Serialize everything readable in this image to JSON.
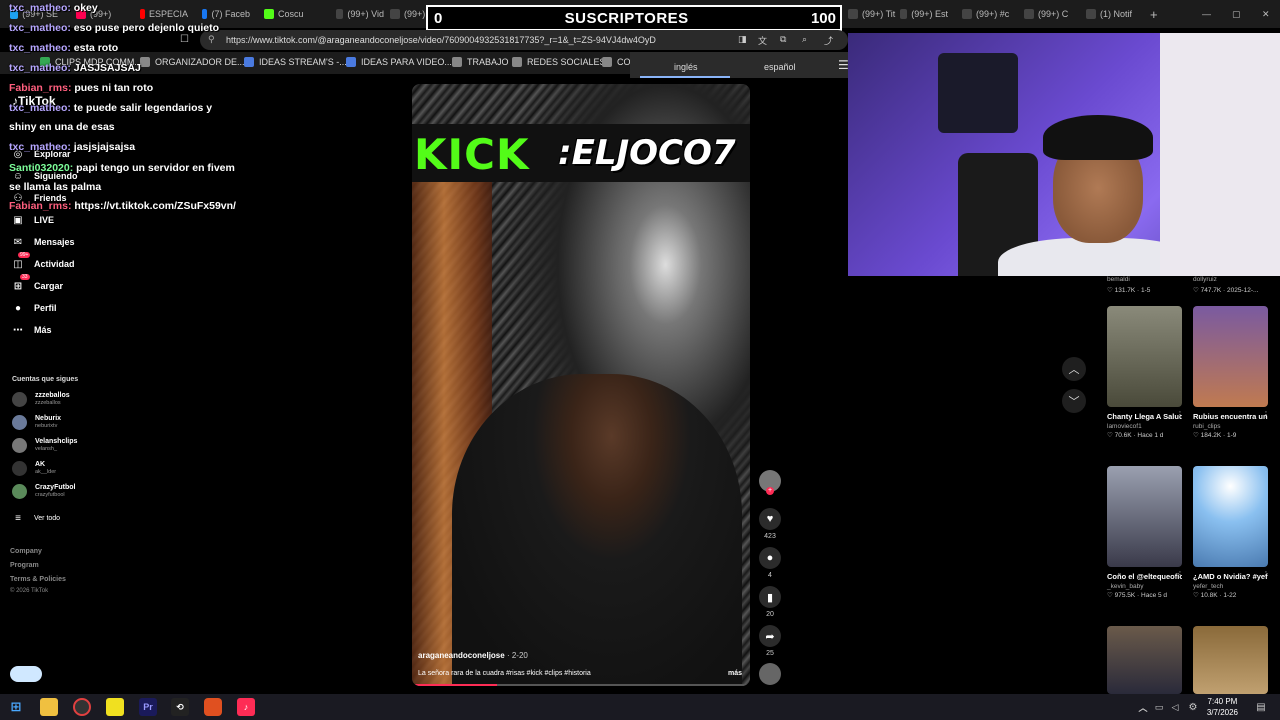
{
  "tabs": [
    {
      "label": "(99+) SE",
      "color": "#1da1f2"
    },
    {
      "label": "(99+) ",
      "color": "#ff0050"
    },
    {
      "label": "ESPECIA",
      "color": "#ff0000"
    },
    {
      "label": "(7) Faceb",
      "color": "#1877f2"
    },
    {
      "label": "Coscu",
      "color": "#53fc18"
    },
    {
      "label": "(99+) Vid",
      "color": "#444444"
    },
    {
      "label": "(99+) Jo",
      "color": "#444444"
    },
    {
      "label": "(99+) ",
      "color": "#444444"
    },
    {
      "label": "(99+) Tit",
      "color": "#444444"
    },
    {
      "label": "(99+) Est",
      "color": "#444444"
    },
    {
      "label": "(99+) #c",
      "color": "#444444"
    },
    {
      "label": "(99+) C",
      "color": "#444444"
    },
    {
      "label": "(1) Notif",
      "color": "#444444"
    }
  ],
  "url": "https://www.tiktok.com/@araganeandoconeljose/video/7609004932531817735?_r=1&_t=ZS-94VJ4dw4OyD",
  "bookmarks": [
    "CLIPS MDP COMM...",
    "ORGANIZADOR DE...",
    "IDEAS STREAM'S -...",
    "IDEAS PARA VIDEO...",
    "TRABAJO",
    "REDES SOCIALES",
    "CO"
  ],
  "subscriber_overlay": {
    "left_number": "0",
    "label": "SUSCRIPTORES",
    "right_number": "100"
  },
  "translate": {
    "source": "inglés",
    "target": "español"
  },
  "chat": [
    {
      "user": "txc_matheo:",
      "msg": "okey",
      "style": "u1"
    },
    {
      "user": "txc_matheo:",
      "msg": "eso puse pero dejenlo quieto",
      "style": "u1"
    },
    {
      "user": "txc_matheo:",
      "msg": "esta roto",
      "style": "u1"
    },
    {
      "user": "txc_matheo:",
      "msg": "JASJSAJSAJ",
      "style": "u1"
    },
    {
      "user": "Fabian_rms:",
      "msg": "pues ni tan roto",
      "style": "u2"
    },
    {
      "user": "txc_matheo:",
      "msg": "te puede salir legendarios y",
      "style": "u1"
    },
    {
      "user": "",
      "msg": "shiny en una de esas",
      "style": "u1"
    },
    {
      "user": "txc_matheo:",
      "msg": "jasjsjajsajsa",
      "style": "u1"
    },
    {
      "user": "Santi032020:",
      "msg": "papi tengo un servidor en fivem",
      "style": "u3"
    },
    {
      "user": "",
      "msg": "se llama las palma",
      "style": "u3"
    },
    {
      "user": "Fabian_rms:",
      "msg": "https://vt.tiktok.com/ZSuFx59vn/",
      "style": "u2"
    }
  ],
  "sidebar": {
    "logo": "TikTok",
    "nav": [
      {
        "label": "Explorar",
        "icon": "compass-icon",
        "glyph": "◎"
      },
      {
        "label": "Siguiendo",
        "icon": "following-icon",
        "glyph": "☺"
      },
      {
        "label": "Friends",
        "icon": "friends-icon",
        "glyph": "⚇"
      },
      {
        "label": "LIVE",
        "icon": "live-icon",
        "glyph": "▣"
      },
      {
        "label": "Mensajes",
        "icon": "messages-icon",
        "glyph": "✉"
      },
      {
        "label": "Actividad",
        "icon": "activity-icon",
        "glyph": "◫"
      },
      {
        "label": "Cargar",
        "icon": "upload-icon",
        "glyph": "⊞"
      },
      {
        "label": "Perfil",
        "icon": "profile-icon",
        "glyph": "●"
      },
      {
        "label": "Más",
        "icon": "more-icon",
        "glyph": "⋯"
      }
    ],
    "badges": {
      "messages": "99+",
      "activity": "33"
    },
    "following_title": "Cuentas que sigues",
    "following": [
      {
        "name": "zzzeballos",
        "handle": "zzzeballos"
      },
      {
        "name": "Neburix",
        "handle": "neburixtv"
      },
      {
        "name": "Velanshclips",
        "handle": "velansh_"
      },
      {
        "name": "AK",
        "handle": "ak__lder"
      },
      {
        "name": "CrazyFutbol",
        "handle": "crazyfutbool"
      }
    ],
    "see_all": "Ver todo",
    "footer": [
      "Company",
      "Program",
      "Terms & Policies",
      "© 2026 TikTok"
    ]
  },
  "video": {
    "banner_left": "KICK",
    "banner_right": ":ELJOCO7",
    "author": "araganeandoconeljose",
    "date": "2-20",
    "caption": "La señora rara de la cuadra #risas #kick #clips #historia",
    "more": "más",
    "progress": 0.25
  },
  "actions": {
    "likes": "423",
    "comments": "4",
    "saves": "20",
    "shares": "25"
  },
  "recommendations": {
    "top_row": [
      {
        "channel": "bemaldi",
        "stats": "♡ 131.7K · 1-5"
      },
      {
        "channel": "dollyruiz",
        "stats": "♡ 747.7K · 2025-12-..."
      }
    ],
    "items": [
      {
        "title": "Chanty Llega A Saludar a Mav...",
        "channel": "lamoviecof1",
        "stats": "♡ 70.6K · Hace 1 d",
        "bg": "linear-gradient(180deg,#8a8a7a,#4a4a3a)"
      },
      {
        "title": "Rubius encuentra un Pokémon...",
        "channel": "rubi_clips",
        "stats": "♡ 184.2K · 1-9",
        "bg": "linear-gradient(180deg,#7a5aa0,#c07a50)"
      },
      {
        "title": "Coño el @eltequeoficial...",
        "channel": "_kevin_baby",
        "stats": "♡ 975.5K · Hace 5 d",
        "bg": "linear-gradient(180deg,#9aa0b0,#3a3a4a)"
      },
      {
        "title": "¿AMD o Nvidia? #yefertech #nvid...",
        "channel": "yefer_tech",
        "stats": "♡ 10.8K · 1-22",
        "bg": "radial-gradient(circle at 50% 20%,#ffffff,#8ac0f0 40%,#4a7ab0)"
      },
      {
        "title": "",
        "channel": "",
        "stats": "",
        "bg": "linear-gradient(180deg,#6a5a4a,#2a2a3a)"
      },
      {
        "title": "",
        "channel": "",
        "stats": "",
        "bg": "linear-gradient(180deg,#8a6a3a,#c0a070)"
      }
    ]
  },
  "taskbar": {
    "time": "7:40 PM",
    "date": "3/7/2026"
  }
}
